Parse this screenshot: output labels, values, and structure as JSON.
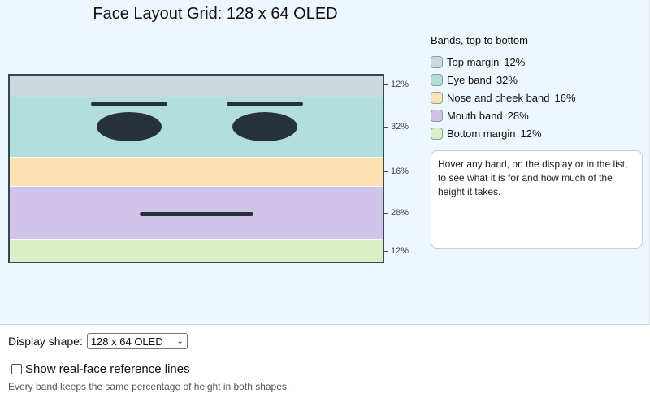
{
  "title": "Face Layout Grid: 128 x 64 OLED",
  "bands": [
    {
      "name": "Top margin",
      "pct_label": "12%",
      "percent": 12,
      "color": "#cfd8dc"
    },
    {
      "name": "Eye band",
      "pct_label": "32%",
      "percent": 32,
      "color": "#b2dfdb"
    },
    {
      "name": "Nose and cheek band",
      "pct_label": "16%",
      "percent": 16,
      "color": "#ffe0b2"
    },
    {
      "name": "Mouth band",
      "pct_label": "28%",
      "percent": 28,
      "color": "#d1c4e9"
    },
    {
      "name": "Bottom margin",
      "pct_label": "12%",
      "percent": 12,
      "color": "#dcedc8"
    }
  ],
  "legend": {
    "title": "Bands, top to bottom"
  },
  "info_text": "Hover any band, on the display or in the list, to see what it is for and how much of the height it takes.",
  "controls": {
    "shape_label": "Display shape:",
    "shape_value": "128 x 64 OLED",
    "reference_label": "Show real-face reference lines",
    "reference_checked": false,
    "hint": "Every band keeps the same percentage of height in both shapes."
  },
  "face_color": "#263238"
}
